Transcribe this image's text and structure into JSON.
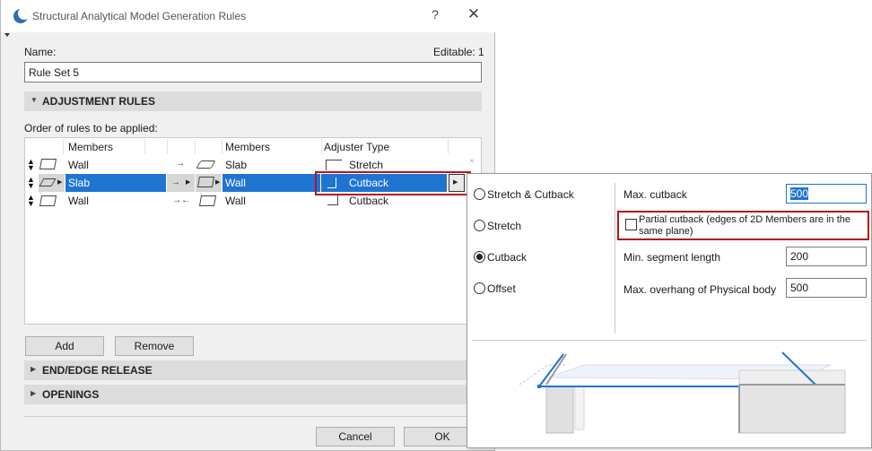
{
  "dialog": {
    "title": "Structural Analytical Model Generation Rules",
    "help_label": "?",
    "close_label": "✕",
    "name_label": "Name:",
    "editable_label": "Editable: 1",
    "name_value": "Rule Set 5",
    "sections": {
      "adjustment": "ADJUSTMENT RULES",
      "end_edge": "END/EDGE RELEASE",
      "openings": "OPENINGS"
    },
    "order_label": "Order of rules to be applied:",
    "table": {
      "headers": {
        "members1": "Members",
        "members2": "Members",
        "adjuster": "Adjuster Type"
      },
      "rows": [
        {
          "m1": "Wall",
          "arrow": "→",
          "m2": "Slab",
          "type": "Stretch"
        },
        {
          "m1": "Slab",
          "arrow": "→",
          "m2": "Wall",
          "type": "Cutback"
        },
        {
          "m1": "Wall",
          "arrow": "→←",
          "m2": "Wall",
          "type": "Cutback"
        }
      ]
    },
    "buttons": {
      "add": "Add",
      "remove": "Remove",
      "cancel": "Cancel",
      "ok": "OK"
    }
  },
  "popup": {
    "options": {
      "stretch_cutback": "Stretch & Cutback",
      "stretch": "Stretch",
      "cutback": "Cutback",
      "offset": "Offset"
    },
    "selected_option": "Cutback",
    "max_cutback_label": "Max. cutback",
    "max_cutback_value": "500",
    "partial_label_1": "Partial cutback (edges of 2D Members are in the",
    "partial_label_2": "same plane)",
    "min_segment_label": "Min. segment length",
    "min_segment_value": "200",
    "max_overhang_label": "Max. overhang of Physical body",
    "max_overhang_value": "500"
  },
  "colors": {
    "selection": "#1f74d2",
    "highlight_border": "#b4141e",
    "preview_line": "#1f74d2"
  }
}
